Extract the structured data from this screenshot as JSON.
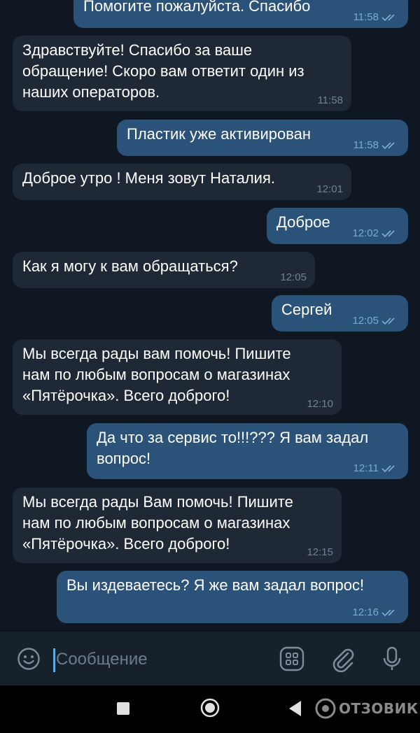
{
  "messages": [
    {
      "side": "out",
      "text": "Помогите пожалуйста. Спасибо",
      "time": "11:58",
      "read": true
    },
    {
      "side": "in",
      "text": "Здравствуйте! Спасибо за ваше\nобращение! Скоро вам ответит один из\nнаших операторов.",
      "time": "11:58"
    },
    {
      "side": "out",
      "text": "Пластик уже активирован",
      "time": "11:58",
      "read": true
    },
    {
      "side": "in",
      "text": "Доброе утро ! Меня зовут Наталия.",
      "time": "12:01"
    },
    {
      "side": "out",
      "text": "Доброе",
      "time": "12:02",
      "read": true
    },
    {
      "side": "in",
      "text": "Как я могу к вам обращаться?",
      "time": "12:05"
    },
    {
      "side": "out",
      "text": "Сергей",
      "time": "12:05",
      "read": true
    },
    {
      "side": "in",
      "text": "Мы всегда рады вам помочь! Пишите\nнам по любым вопросам о магазинах\n«Пятёрочка». Всего доброго!",
      "time": "12:10"
    },
    {
      "side": "out",
      "text": "Да что за сервис то!!!??? Я вам задал\nвопрос!",
      "time": "12:11",
      "read": true
    },
    {
      "side": "in",
      "text": "Мы всегда рады Вам помочь! Пишите\nнам по любым вопросам о магазинах\n«Пятёрочка». Всего доброго!",
      "time": "12:15"
    },
    {
      "side": "out",
      "text": "Вы издеваетесь? Я же вам задал вопрос!",
      "time": "12:16",
      "read": true
    }
  ],
  "composer": {
    "placeholder": "Сообщение",
    "icons": [
      "emoji-icon",
      "sticker-icon",
      "attach-icon",
      "microphone-icon"
    ]
  },
  "navbar": {
    "icons": [
      "recents-icon",
      "home-icon",
      "back-icon"
    ]
  },
  "watermark": {
    "text": "ОТЗОВИК"
  },
  "colors": {
    "background": "#0f1722",
    "incoming_bubble": "#1f2936",
    "outgoing_bubble": "#2b5278",
    "accent": "#5ea9e6"
  }
}
